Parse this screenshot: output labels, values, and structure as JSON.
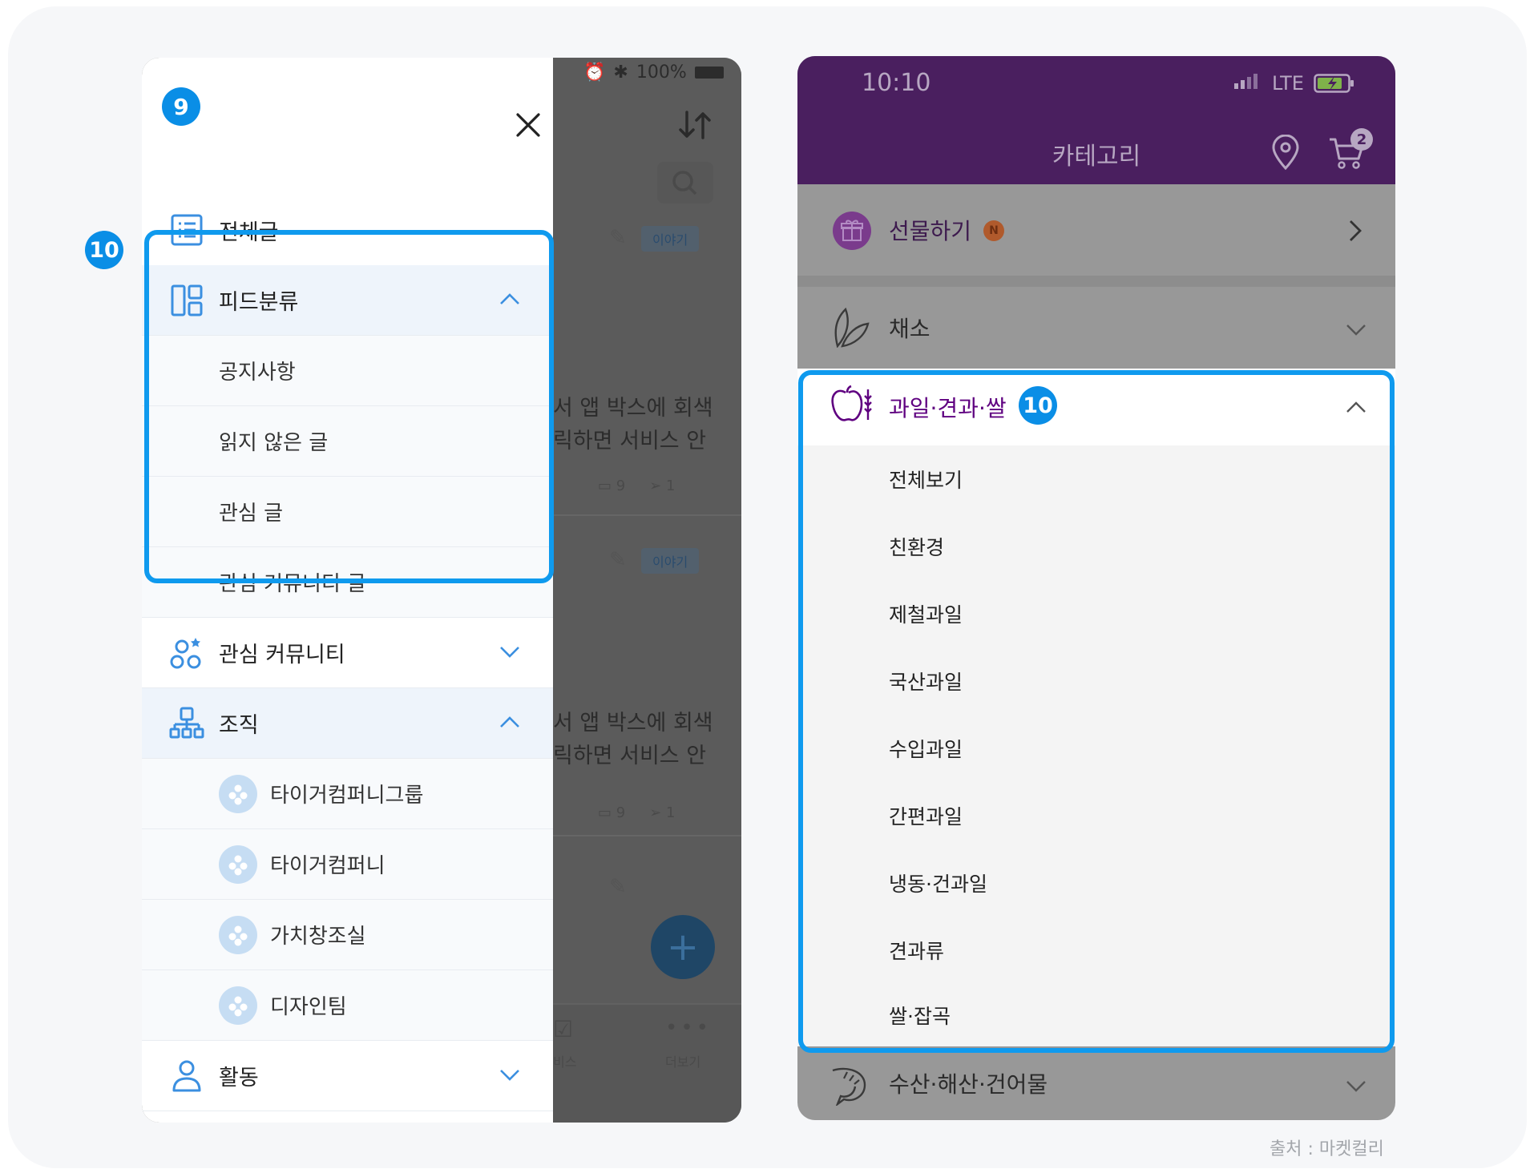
{
  "left_panel": {
    "step_badge": "9",
    "section_badge": "10",
    "status_bar": {
      "battery": "100%"
    },
    "menu": {
      "all_posts": "전체글",
      "feed_category": "피드분류",
      "feed_items": [
        "공지사항",
        "읽지 않은 글",
        "관심 글",
        "관심 커뮤니티 글"
      ],
      "interest_community": "관심 커뮤니티",
      "organization": "조직",
      "org_items": [
        "타이거컴퍼니그룹",
        "타이거컴퍼니",
        "가치창조실",
        "디자인팀"
      ],
      "activity": "활동"
    },
    "background_app": {
      "tag_1": "이야기",
      "post_1_line1": "서 앱 박스에 회색",
      "post_1_line2": "릭하면 서비스 안",
      "comment_count_1": "9",
      "share_count_1": "1",
      "tag_2": "이야기",
      "post_2_line1": "서 앱 박스에 회색",
      "post_2_line2": "릭하면 서비스 안",
      "comment_count_2": "9",
      "share_count_2": "1",
      "nav_service": "비스",
      "nav_more": "더보기",
      "fab": "+"
    }
  },
  "right_panel": {
    "status_bar": {
      "time": "10:10",
      "network": "LTE"
    },
    "header": {
      "title": "카테고리",
      "cart_count": "2"
    },
    "gift": {
      "label": "선물하기",
      "new_badge": "N"
    },
    "categories": {
      "vegetables": "채소",
      "fruits": "과일·견과·쌀",
      "fruit_badge": "10",
      "fruit_items": [
        "전체보기",
        "친환경",
        "제철과일",
        "국산과일",
        "수입과일",
        "간편과일",
        "냉동·건과일",
        "견과류",
        "쌀·잡곡"
      ],
      "seafood": "수산·해산·건어물"
    }
  },
  "source_note": "출처 : 마켓컬리",
  "colors": {
    "highlight_blue": "#0f9aee",
    "badge_blue": "#0a8ee6",
    "kurly_purple": "#4a1f5f",
    "fruit_purple": "#5f0080",
    "icon_blue": "#3b8fe0"
  }
}
